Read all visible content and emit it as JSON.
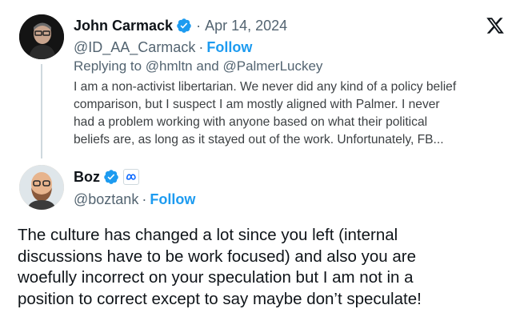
{
  "parent_tweet": {
    "author_name": "John Carmack",
    "date": "Apr 14, 2024",
    "handle": "@ID_AA_Carmack",
    "follow_label": "Follow",
    "reply_prefix": "Replying to",
    "reply_mention_1": "@hmltn",
    "reply_and": "and",
    "reply_mention_2": "@PalmerLuckey",
    "text_lines": [
      "I am a non-activist libertarian. We never did any kind of a policy belief",
      "comparison, but I suspect I am mostly aligned with Palmer. I never",
      "had a problem working with anyone based on what their political",
      "beliefs are, as long as it stayed out of the work. Unfortunately, FB..."
    ]
  },
  "reply_tweet": {
    "author_name": "Boz",
    "handle": "@boztank",
    "follow_label": "Follow",
    "affiliate_icon": "meta-icon",
    "text_lines": [
      "The culture has changed a lot since you left (internal",
      "discussions have to be work focused) and also you are",
      "woefully incorrect on your speculation but I am not in a",
      "position to correct except to say maybe don’t speculate!"
    ]
  },
  "separator_dot": "·",
  "icons": {
    "verified": "verified-badge-icon",
    "logo": "x-logo-icon"
  },
  "colors": {
    "text": "#0f1419",
    "muted": "#536471",
    "accent": "#1d9bf0",
    "thread_line": "#cfd9de"
  }
}
